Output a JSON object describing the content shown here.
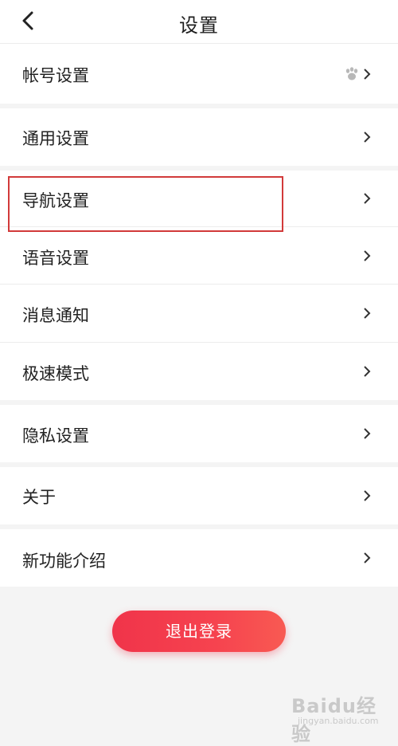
{
  "header": {
    "title": "设置",
    "back_icon": "chevron-left-icon"
  },
  "menu": {
    "account": "帐号设置",
    "general": "通用设置",
    "navigation": "导航设置",
    "voice": "语音设置",
    "message": "消息通知",
    "speed": "极速模式",
    "privacy": "隐私设置",
    "about": "关于",
    "new_features": "新功能介绍"
  },
  "account_badge_icon": "paw-icon",
  "logout_label": "退出登录",
  "watermark": {
    "main": "Baidu经验",
    "sub": "jingyan.baidu.com"
  },
  "colors": {
    "accent": "#f0344a",
    "highlight_border": "#d23a3a"
  }
}
